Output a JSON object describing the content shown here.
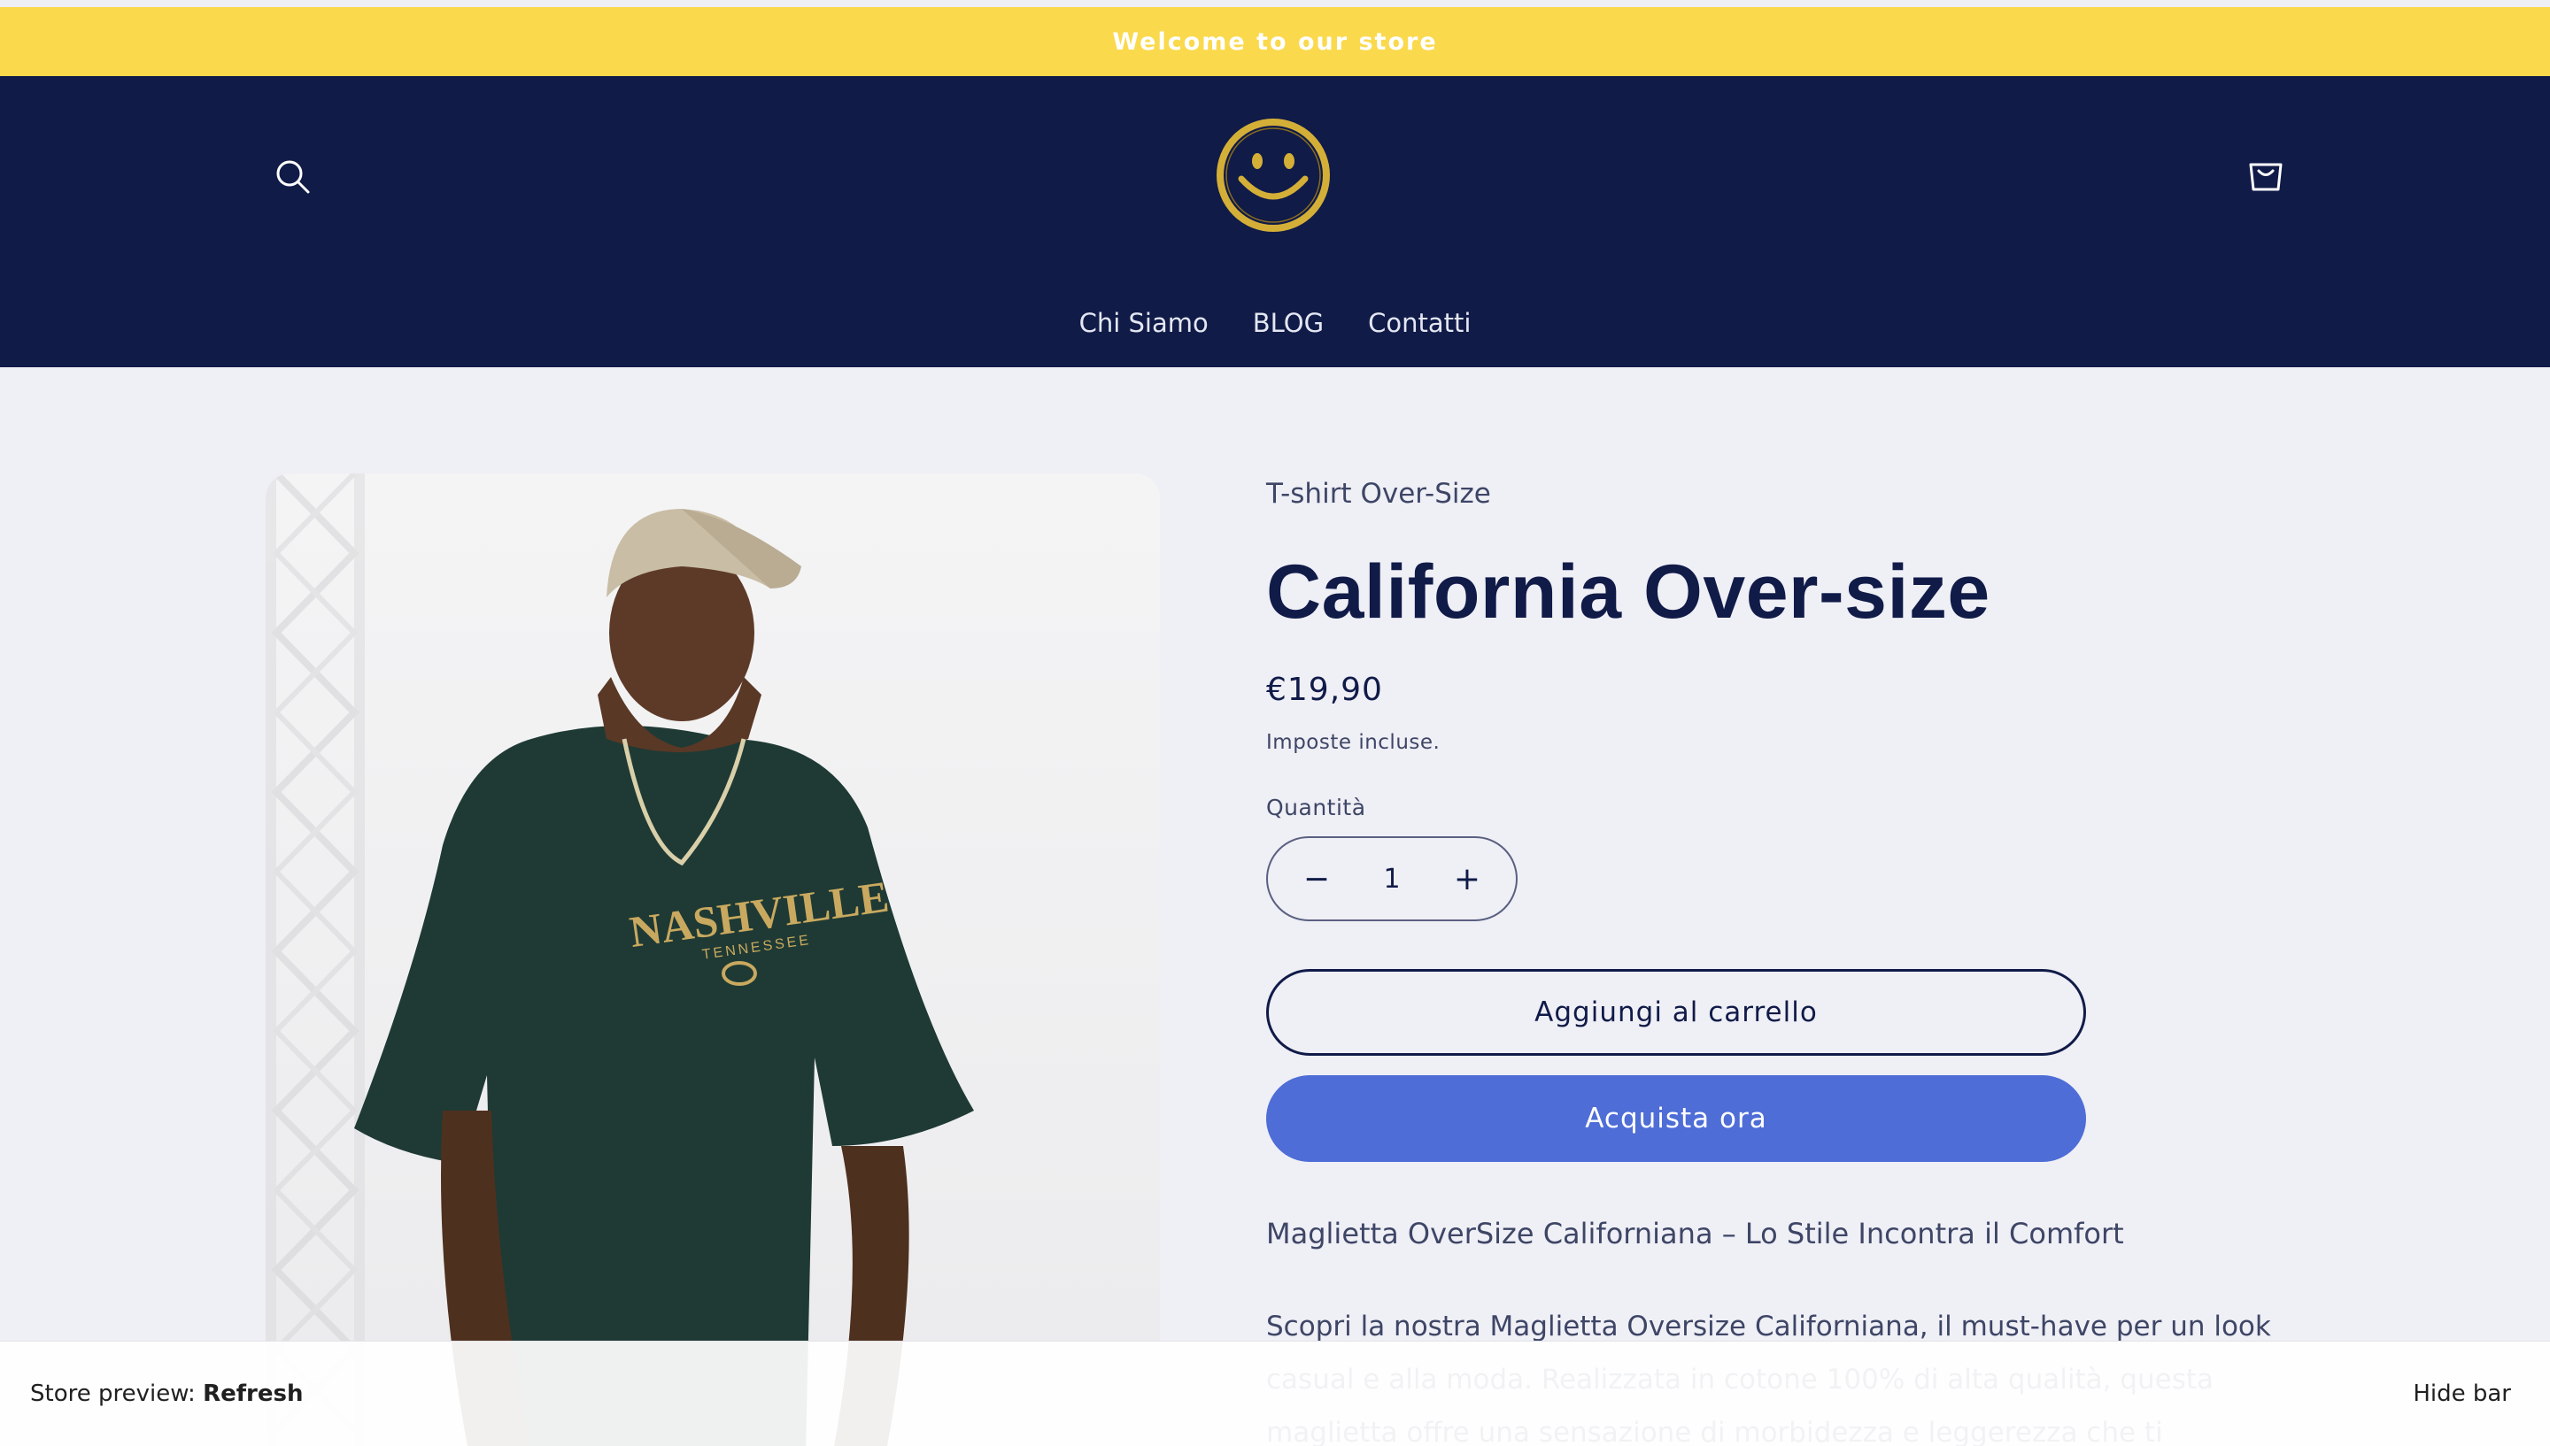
{
  "announcement": {
    "text": "Welcome to our store"
  },
  "header": {
    "nav": [
      "Chi Siamo",
      "BLOG",
      "Contatti"
    ],
    "colors": {
      "header_bg": "#101b48",
      "announcement_bg": "#fad94d",
      "logo": "#d4af37"
    }
  },
  "product": {
    "vendor": "T-shirt Over-Size",
    "title": "California Over-size",
    "price": "€19,90",
    "tax_note": "Imposte incluse.",
    "quantity_label": "Quantità",
    "quantity_value": "1",
    "decrease_symbol": "−",
    "increase_symbol": "+",
    "add_to_cart": "Aggiungi al carrello",
    "buy_now": "Acquista ora",
    "description_heading": "Maglietta OverSize Californiana – Lo Stile Incontra il Comfort",
    "description_body": "Scopri la nostra Maglietta Oversize Californiana, il must-have per un look casual e alla moda. Realizzata in cotone 100% di alta qualità, questa maglietta offre una sensazione di morbidezza e leggerezza che ti"
  },
  "image": {
    "shirt_text": "NASHVILLE",
    "shirt_subtext": "TENNESSEE"
  },
  "preview_bar": {
    "label": "Store preview:",
    "refresh": "Refresh",
    "hide": "Hide bar"
  }
}
